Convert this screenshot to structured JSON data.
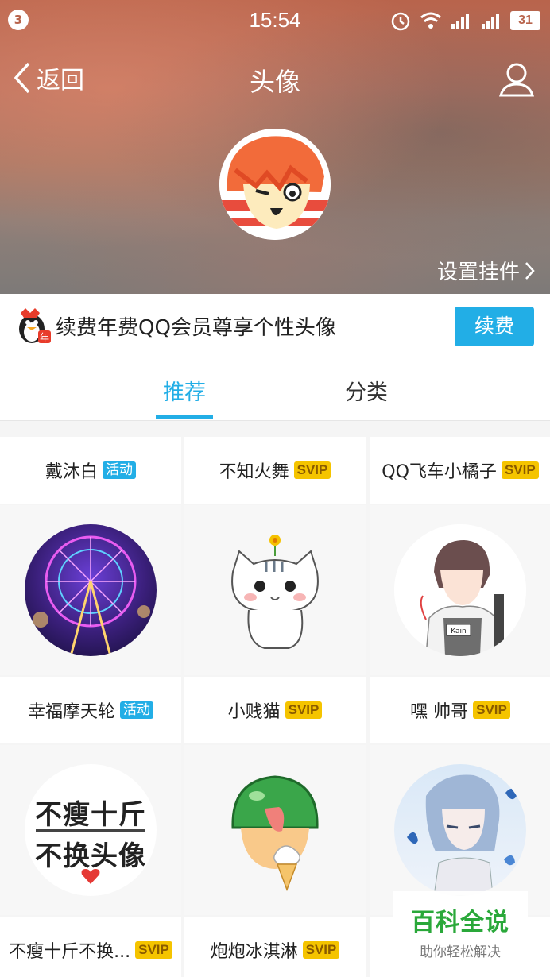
{
  "status": {
    "notification_count": "3",
    "time": "15:54",
    "battery": "31"
  },
  "nav": {
    "back_label": "返回",
    "title": "头像"
  },
  "pendant_link": "设置挂件",
  "banner": {
    "text": "续费年费QQ会员尊享个性头像",
    "button": "续费"
  },
  "tabs": [
    {
      "label": "推荐"
    },
    {
      "label": "分类"
    }
  ],
  "grid": {
    "row1": [
      {
        "name": "戴沐白",
        "tag": "活动"
      },
      {
        "name": "不知火舞",
        "tag": "SVIP"
      },
      {
        "name": "QQ飞车小橘子",
        "tag": "SVIP"
      }
    ],
    "row2": [
      {
        "name": "幸福摩天轮",
        "tag": "活动"
      },
      {
        "name": "小贱猫",
        "tag": "SVIP"
      },
      {
        "name": "嘿 帅哥",
        "tag": "SVIP"
      }
    ],
    "row3": [
      {
        "name": "不瘦十斤不换...",
        "tag": "SVIP"
      },
      {
        "name": "炮炮冰淇淋",
        "tag": "SVIP"
      },
      {
        "name": "",
        "tag": ""
      }
    ],
    "image_texts": {
      "slim_line1": "不瘦十斤",
      "slim_line2": "不换头像",
      "boy_badge": "Kain"
    }
  },
  "watermark": {
    "main": "百科全说",
    "sub": "助你轻松解决"
  },
  "colors": {
    "accent": "#22aee6",
    "svip": "#f5c400"
  }
}
